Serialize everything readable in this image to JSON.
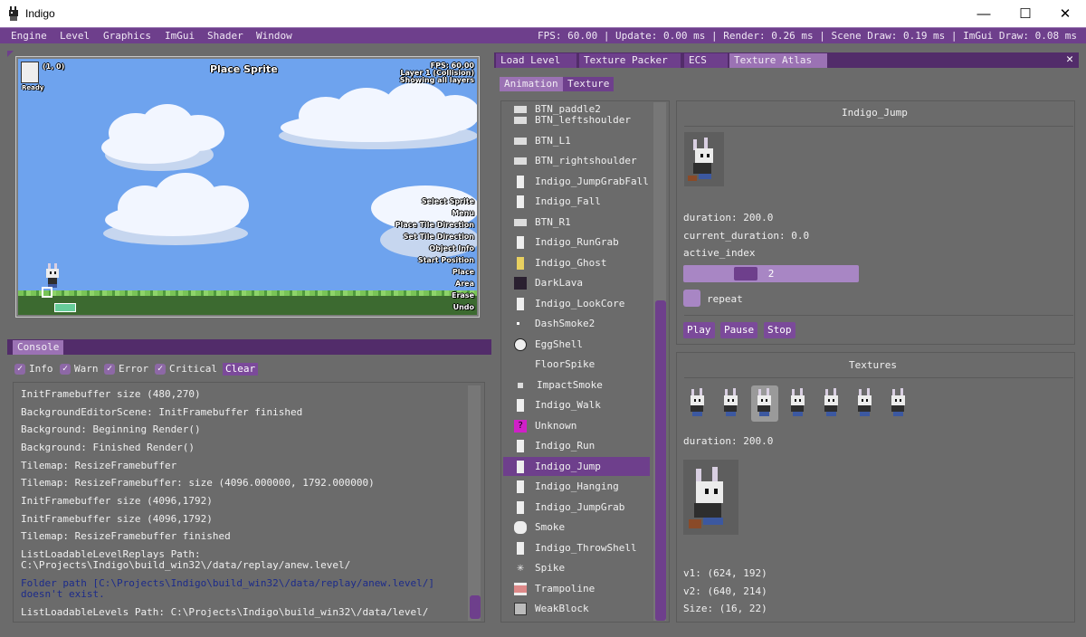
{
  "window": {
    "title": "Indigo",
    "minimize": "—",
    "maximize": "☐",
    "close": "✕"
  },
  "menubar": {
    "items": [
      "Engine",
      "Level",
      "Graphics",
      "ImGui",
      "Shader",
      "Window"
    ],
    "stats": "FPS: 60.00 | Update: 0.00 ms | Render: 0.26 ms | Scene Draw: 0.19 ms | ImGui Draw: 0.08 ms"
  },
  "scene": {
    "title": "Place Sprite",
    "coords": "(1, 0)",
    "avatar_caption": "Ready",
    "info": [
      "FPS: 60.00",
      "Layer 1 (Collision)",
      "Showing all layers"
    ],
    "hints": [
      "Select Sprite",
      "Menu",
      "Place Tile Direction",
      "Set Tile Direction",
      "Object Info",
      "Start Position",
      "Place",
      "Area",
      "Erase",
      "Undo"
    ]
  },
  "console": {
    "tab": "Console",
    "filters": [
      "Info",
      "Warn",
      "Error",
      "Critical"
    ],
    "clear": "Clear",
    "lines": [
      "InitFramebuffer size (480,270)",
      "BackgroundEditorScene: InitFramebuffer finished",
      "Background: Beginning Render()",
      "Background: Finished Render()",
      "Tilemap: ResizeFramebuffer",
      "Tilemap: ResizeFramebuffer: size (4096.000000, 1792.000000)",
      "InitFramebuffer size (4096,1792)",
      "InitFramebuffer size (4096,1792)",
      "Tilemap: ResizeFramebuffer finished",
      "ListLoadableLevelReplays Path:",
      "C:\\Projects\\Indigo\\build_win32\\/data/replay/anew.level/",
      "Folder path [C:\\Projects\\Indigo\\build_win32\\/data/replay/anew.level/]",
      "doesn't exist.",
      "ListLoadableLevels Path: C:\\Projects\\Indigo\\build_win32\\/data/level/"
    ]
  },
  "right": {
    "tabs": [
      "Load Level",
      "Texture Packer",
      "ECS",
      "Texture Atlas"
    ],
    "close": "✕",
    "subtabs": [
      "Animation",
      "Texture"
    ],
    "list": [
      "BTN_paddle2",
      "BTN_leftshoulder",
      "BTN_L1",
      "BTN_rightshoulder",
      "Indigo_JumpGrabFallF",
      "Indigo_Fall",
      "BTN_R1",
      "Indigo_RunGrab",
      "Indigo_Ghost",
      "DarkLava",
      "Indigo_LookCore",
      "DashSmoke2",
      "EggShell",
      "FloorSpike",
      "ImpactSmoke",
      "Indigo_Walk",
      "Unknown",
      "Indigo_Run",
      "Indigo_Jump",
      "Indigo_Hanging",
      "Indigo_JumpGrab",
      "Smoke",
      "Indigo_ThrowShell",
      "Spike",
      "Trampoline",
      "WeakBlock"
    ],
    "selected": "Indigo_Jump",
    "anim": {
      "name": "Indigo_Jump",
      "duration": "duration: 200.0",
      "current_duration": "current_duration: 0.0",
      "active_index_label": "active_index",
      "active_index": "2",
      "active_index_fraction": 0.5,
      "repeat": "repeat",
      "play": "Play",
      "pause": "Pause",
      "stop": "Stop"
    },
    "textures": {
      "title": "Textures",
      "duration": "duration: 200.0",
      "v1": "v1: (624, 192)",
      "v2": "v2: (640, 214)",
      "size": "Size: (16, 22)"
    }
  }
}
